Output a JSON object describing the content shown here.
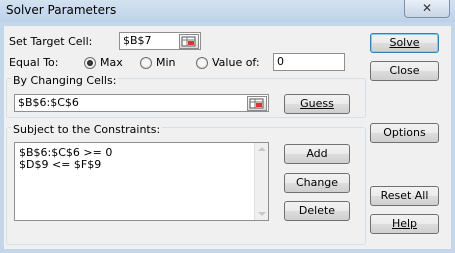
{
  "window": {
    "title": "Solver Parameters",
    "close_glyph": "✕"
  },
  "target": {
    "label": "Set Target Cell:",
    "value": "$B$7"
  },
  "equal_to": {
    "label": "Equal To:",
    "options": [
      {
        "label": "Max",
        "selected": true
      },
      {
        "label": "Min",
        "selected": false
      },
      {
        "label": "Value of:",
        "selected": false
      }
    ],
    "value_of": "0"
  },
  "changing": {
    "label": "By Changing Cells:",
    "value": "$B$6:$C$6",
    "guess_label": "Guess"
  },
  "constraints": {
    "label": "Subject to the Constraints:",
    "items": [
      "$B$6:$C$6 >= 0",
      "$D$9 <= $F$9"
    ],
    "add_label": "Add",
    "change_label": "Change",
    "delete_label": "Delete"
  },
  "side_buttons": {
    "solve": "Solve",
    "close": "Close",
    "options": "Options",
    "reset": "Reset All",
    "help": "Help"
  },
  "icons": {
    "close": "close-icon",
    "ref": "range-selector-icon",
    "scroll_up": "scroll-up-arrow-icon",
    "scroll_down": "scroll-down-arrow-icon"
  }
}
